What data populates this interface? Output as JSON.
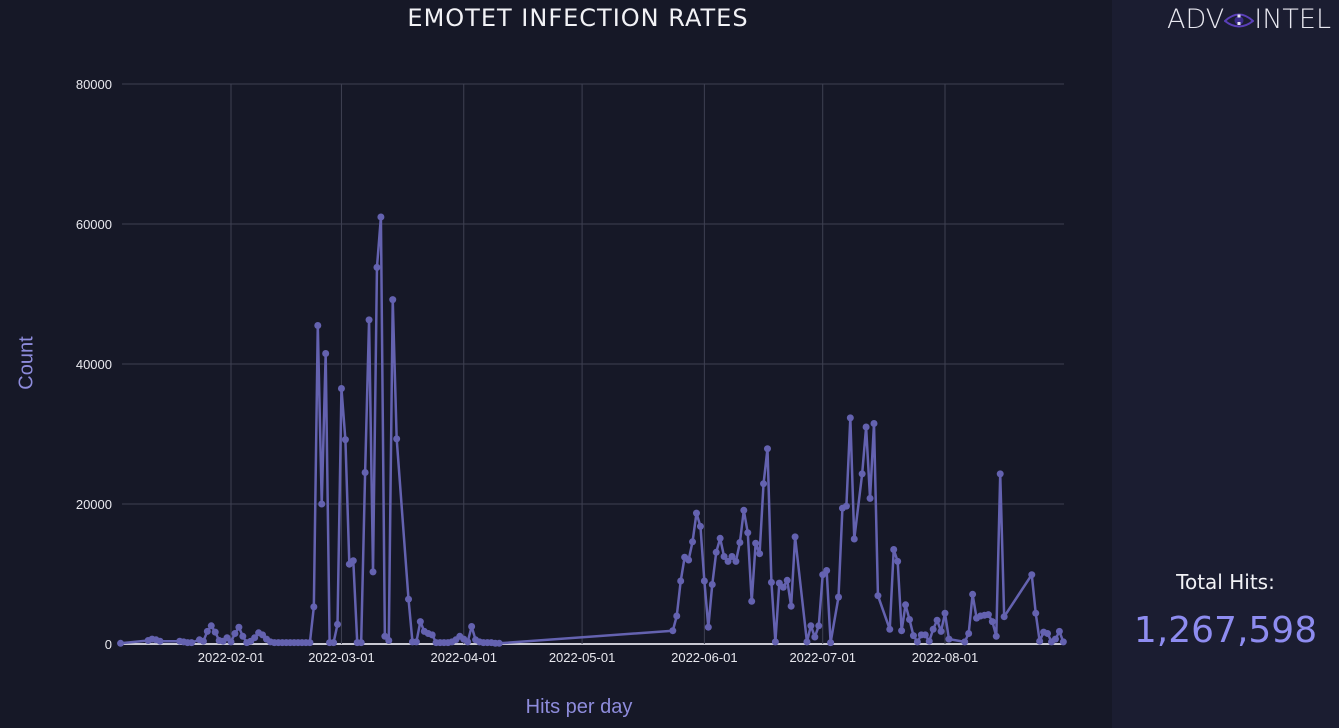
{
  "brand": {
    "logo_left": "ADV",
    "logo_right": "INTEL",
    "logo_icon": "eye-icon"
  },
  "summary": {
    "total_label": "Total Hits:",
    "total_value": "1,267,598"
  },
  "colors": {
    "series": "#6462b0",
    "axis_label": "#8e8cdc",
    "total_value": "#8e8cf0",
    "background": "#161827",
    "panel": "#1b1d31"
  },
  "chart_data": {
    "type": "line",
    "title": "EMOTET INFECTION RATES",
    "xlabel": "Hits per day",
    "ylabel": "Count",
    "ylim": [
      0,
      80000
    ],
    "yticks": [
      0,
      20000,
      40000,
      60000,
      80000
    ],
    "xlim": [
      "2022-01-04",
      "2022-08-31"
    ],
    "xticks": [
      "2022-02-01",
      "2022-03-01",
      "2022-04-01",
      "2022-05-01",
      "2022-06-01",
      "2022-07-01",
      "2022-08-01"
    ],
    "grid": true,
    "legend": "none",
    "series": [
      {
        "name": "Hits per day",
        "points": [
          [
            "2022-01-04",
            100
          ],
          [
            "2022-01-11",
            500
          ],
          [
            "2022-01-12",
            700
          ],
          [
            "2022-01-13",
            600
          ],
          [
            "2022-01-14",
            400
          ],
          [
            "2022-01-19",
            400
          ],
          [
            "2022-01-20",
            300
          ],
          [
            "2022-01-21",
            200
          ],
          [
            "2022-01-22",
            200
          ],
          [
            "2022-01-24",
            600
          ],
          [
            "2022-01-25",
            400
          ],
          [
            "2022-01-26",
            1800
          ],
          [
            "2022-01-27",
            2600
          ],
          [
            "2022-01-28",
            1700
          ],
          [
            "2022-01-29",
            500
          ],
          [
            "2022-01-30",
            400
          ],
          [
            "2022-01-31",
            900
          ],
          [
            "2022-02-01",
            300
          ],
          [
            "2022-02-02",
            1500
          ],
          [
            "2022-02-03",
            2400
          ],
          [
            "2022-02-04",
            1100
          ],
          [
            "2022-02-05",
            200
          ],
          [
            "2022-02-06",
            400
          ],
          [
            "2022-02-07",
            900
          ],
          [
            "2022-02-08",
            1600
          ],
          [
            "2022-02-09",
            1300
          ],
          [
            "2022-02-10",
            700
          ],
          [
            "2022-02-11",
            300
          ],
          [
            "2022-02-12",
            200
          ],
          [
            "2022-02-13",
            200
          ],
          [
            "2022-02-14",
            200
          ],
          [
            "2022-02-15",
            200
          ],
          [
            "2022-02-16",
            200
          ],
          [
            "2022-02-17",
            200
          ],
          [
            "2022-02-18",
            200
          ],
          [
            "2022-02-19",
            200
          ],
          [
            "2022-02-20",
            200
          ],
          [
            "2022-02-21",
            200
          ],
          [
            "2022-02-22",
            5300
          ],
          [
            "2022-02-23",
            45500
          ],
          [
            "2022-02-24",
            20000
          ],
          [
            "2022-02-25",
            41500
          ],
          [
            "2022-02-26",
            200
          ],
          [
            "2022-02-27",
            200
          ],
          [
            "2022-02-28",
            2800
          ],
          [
            "2022-03-01",
            36500
          ],
          [
            "2022-03-02",
            29200
          ],
          [
            "2022-03-03",
            11400
          ],
          [
            "2022-03-04",
            11900
          ],
          [
            "2022-03-05",
            200
          ],
          [
            "2022-03-06",
            200
          ],
          [
            "2022-03-07",
            24500
          ],
          [
            "2022-03-08",
            46300
          ],
          [
            "2022-03-09",
            10300
          ],
          [
            "2022-03-10",
            53800
          ],
          [
            "2022-03-11",
            61000
          ],
          [
            "2022-03-12",
            1100
          ],
          [
            "2022-03-13",
            500
          ],
          [
            "2022-03-14",
            49200
          ],
          [
            "2022-03-15",
            29300
          ],
          [
            "2022-03-18",
            6400
          ],
          [
            "2022-03-19",
            300
          ],
          [
            "2022-03-20",
            300
          ],
          [
            "2022-03-21",
            3200
          ],
          [
            "2022-03-22",
            1800
          ],
          [
            "2022-03-23",
            1500
          ],
          [
            "2022-03-24",
            1300
          ],
          [
            "2022-03-25",
            200
          ],
          [
            "2022-03-26",
            200
          ],
          [
            "2022-03-27",
            200
          ],
          [
            "2022-03-28",
            200
          ],
          [
            "2022-03-29",
            300
          ],
          [
            "2022-03-30",
            600
          ],
          [
            "2022-03-31",
            1100
          ],
          [
            "2022-04-01",
            700
          ],
          [
            "2022-04-02",
            300
          ],
          [
            "2022-04-03",
            2500
          ],
          [
            "2022-04-04",
            600
          ],
          [
            "2022-04-05",
            300
          ],
          [
            "2022-04-06",
            200
          ],
          [
            "2022-04-07",
            200
          ],
          [
            "2022-04-08",
            200
          ],
          [
            "2022-04-09",
            100
          ],
          [
            "2022-04-10",
            100
          ],
          [
            "2022-05-24",
            1900
          ],
          [
            "2022-05-25",
            4000
          ],
          [
            "2022-05-26",
            9000
          ],
          [
            "2022-05-27",
            12400
          ],
          [
            "2022-05-28",
            12000
          ],
          [
            "2022-05-29",
            14600
          ],
          [
            "2022-05-30",
            18700
          ],
          [
            "2022-05-31",
            16800
          ],
          [
            "2022-06-01",
            9000
          ],
          [
            "2022-06-02",
            2400
          ],
          [
            "2022-06-03",
            8500
          ],
          [
            "2022-06-04",
            13100
          ],
          [
            "2022-06-05",
            15100
          ],
          [
            "2022-06-06",
            12500
          ],
          [
            "2022-06-07",
            11800
          ],
          [
            "2022-06-08",
            12500
          ],
          [
            "2022-06-09",
            11800
          ],
          [
            "2022-06-10",
            14500
          ],
          [
            "2022-06-11",
            19100
          ],
          [
            "2022-06-12",
            15900
          ],
          [
            "2022-06-13",
            6100
          ],
          [
            "2022-06-14",
            14400
          ],
          [
            "2022-06-15",
            12900
          ],
          [
            "2022-06-16",
            22900
          ],
          [
            "2022-06-17",
            27900
          ],
          [
            "2022-06-18",
            8800
          ],
          [
            "2022-06-19",
            300
          ],
          [
            "2022-06-20",
            8700
          ],
          [
            "2022-06-21",
            8100
          ],
          [
            "2022-06-22",
            9100
          ],
          [
            "2022-06-23",
            5400
          ],
          [
            "2022-06-24",
            15300
          ],
          [
            "2022-06-27",
            300
          ],
          [
            "2022-06-28",
            2600
          ],
          [
            "2022-06-29",
            1000
          ],
          [
            "2022-06-30",
            2600
          ],
          [
            "2022-07-01",
            9900
          ],
          [
            "2022-07-02",
            10500
          ],
          [
            "2022-07-03",
            200
          ],
          [
            "2022-07-05",
            6700
          ],
          [
            "2022-07-06",
            19400
          ],
          [
            "2022-07-07",
            19700
          ],
          [
            "2022-07-08",
            32300
          ],
          [
            "2022-07-09",
            15000
          ],
          [
            "2022-07-11",
            24300
          ],
          [
            "2022-07-12",
            31000
          ],
          [
            "2022-07-13",
            20800
          ],
          [
            "2022-07-14",
            31500
          ],
          [
            "2022-07-15",
            6900
          ],
          [
            "2022-07-18",
            2100
          ],
          [
            "2022-07-19",
            13500
          ],
          [
            "2022-07-20",
            11800
          ],
          [
            "2022-07-21",
            1900
          ],
          [
            "2022-07-22",
            5600
          ],
          [
            "2022-07-23",
            3500
          ],
          [
            "2022-07-24",
            1200
          ],
          [
            "2022-07-25",
            300
          ],
          [
            "2022-07-26",
            1300
          ],
          [
            "2022-07-27",
            1300
          ],
          [
            "2022-07-28",
            400
          ],
          [
            "2022-07-29",
            2100
          ],
          [
            "2022-07-30",
            3400
          ],
          [
            "2022-07-31",
            1800
          ],
          [
            "2022-08-01",
            4400
          ],
          [
            "2022-08-02",
            700
          ],
          [
            "2022-08-06",
            300
          ],
          [
            "2022-08-07",
            1500
          ],
          [
            "2022-08-08",
            7100
          ],
          [
            "2022-08-09",
            3700
          ],
          [
            "2022-08-10",
            4000
          ],
          [
            "2022-08-11",
            4100
          ],
          [
            "2022-08-12",
            4200
          ],
          [
            "2022-08-13",
            3200
          ],
          [
            "2022-08-14",
            1100
          ],
          [
            "2022-08-15",
            24300
          ],
          [
            "2022-08-16",
            3900
          ],
          [
            "2022-08-23",
            9900
          ],
          [
            "2022-08-24",
            4400
          ],
          [
            "2022-08-25",
            400
          ],
          [
            "2022-08-26",
            1700
          ],
          [
            "2022-08-27",
            1500
          ],
          [
            "2022-08-28",
            300
          ],
          [
            "2022-08-29",
            700
          ],
          [
            "2022-08-30",
            1800
          ],
          [
            "2022-08-31",
            300
          ]
        ]
      }
    ]
  }
}
